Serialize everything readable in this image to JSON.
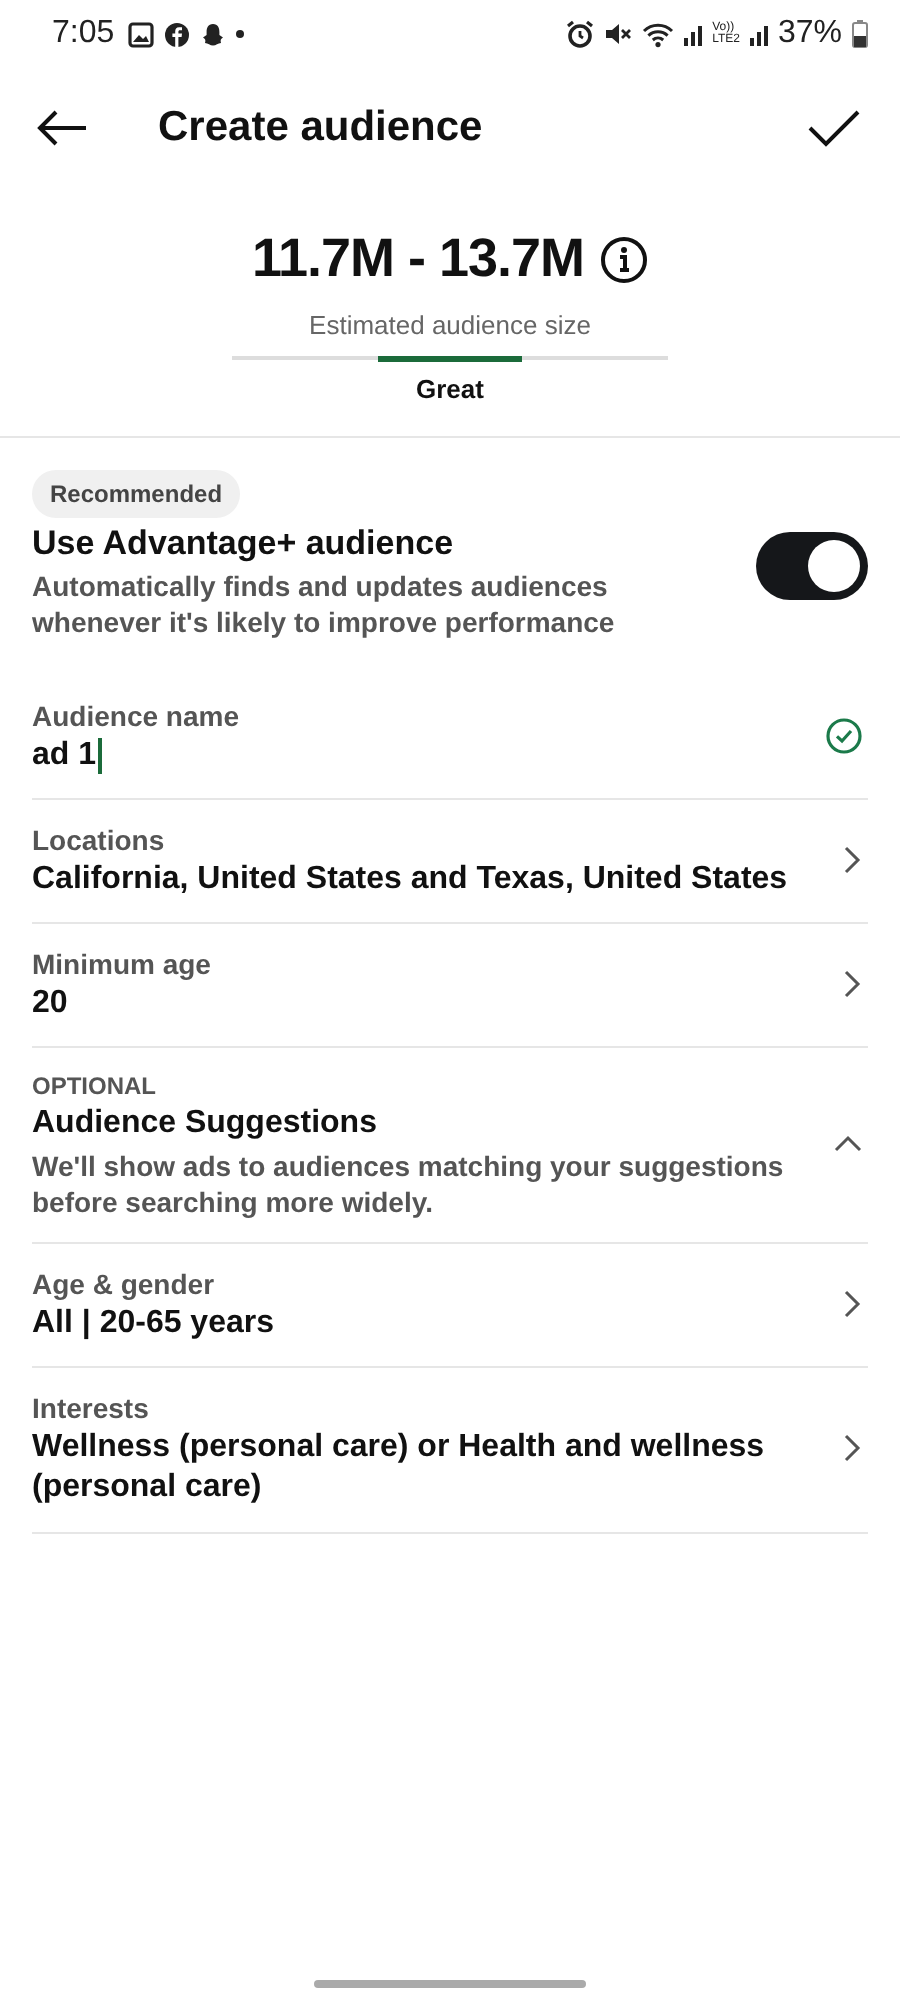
{
  "status_bar": {
    "time": "7:05",
    "network_top": "Vo))",
    "network_bottom": "LTE2",
    "battery": "37%"
  },
  "header": {
    "title": "Create audience"
  },
  "estimate": {
    "range": "11.7M - 13.7M",
    "caption": "Estimated audience size",
    "segments": [
      {
        "selected": false
      },
      {
        "selected": true
      },
      {
        "selected": false
      }
    ],
    "rating": "Great"
  },
  "advantage": {
    "badge": "Recommended",
    "title": "Use Advantage+ audience",
    "description": "Automatically finds and updates audiences whenever it's likely to improve performance",
    "on": true
  },
  "rows": [
    {
      "kind": "field",
      "label": "Audience name",
      "value": "ad 1",
      "valid": true
    },
    {
      "kind": "nav",
      "label": "Locations",
      "value": "California, United States and Texas, United States"
    },
    {
      "kind": "nav",
      "label": "Minimum age",
      "value": "20"
    },
    {
      "kind": "section",
      "overline": "OPTIONAL",
      "title": "Audience Suggestions",
      "description": "We'll show ads to audiences matching your suggestions before searching more widely.",
      "expanded": true
    },
    {
      "kind": "nav",
      "label": "Age & gender",
      "value": "All | 20-65 years"
    },
    {
      "kind": "nav",
      "label": "Interests",
      "value": "Wellness (personal care) or Health and wellness (personal care)"
    }
  ]
}
